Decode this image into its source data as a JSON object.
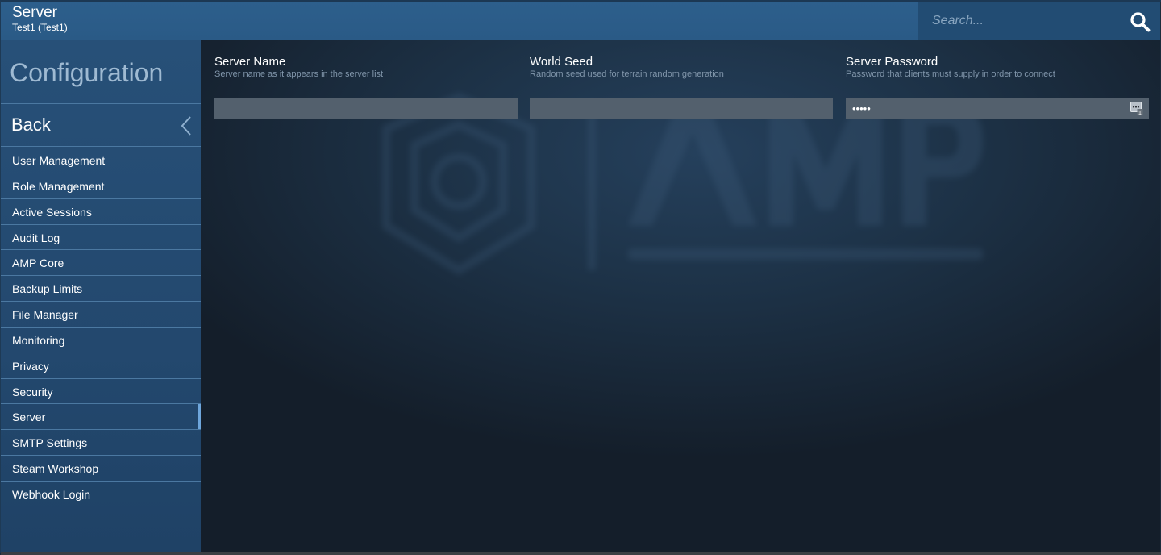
{
  "header": {
    "title": "Server",
    "subtitle": "Test1 (Test1)"
  },
  "search": {
    "placeholder": "Search...",
    "icon": "search-icon"
  },
  "sidebar": {
    "heading": "Configuration",
    "back_label": "Back",
    "items": [
      {
        "label": "User Management"
      },
      {
        "label": "Role Management"
      },
      {
        "label": "Active Sessions"
      },
      {
        "label": "Audit Log"
      },
      {
        "label": "AMP Core"
      },
      {
        "label": "Backup Limits"
      },
      {
        "label": "File Manager"
      },
      {
        "label": "Monitoring"
      },
      {
        "label": "Privacy"
      },
      {
        "label": "Security"
      },
      {
        "label": "Server",
        "active": true
      },
      {
        "label": "SMTP Settings"
      },
      {
        "label": "Steam Workshop"
      },
      {
        "label": "Webhook Login"
      }
    ]
  },
  "fields": [
    {
      "label": "Server Name",
      "help": "Server name as it appears in the server list",
      "value": ""
    },
    {
      "label": "World Seed",
      "help": "Random seed used for terrain random generation",
      "value": ""
    },
    {
      "label": "Server Password",
      "help": "Password that clients must supply in order to connect",
      "value": "•••••",
      "type": "password"
    }
  ],
  "colors": {
    "header_bg": "#2d5f8c",
    "sidebar_bg": "#255078",
    "main_bg": "#16202c",
    "active_indicator": "#6ea6dc",
    "input_bg": "#53606d"
  }
}
